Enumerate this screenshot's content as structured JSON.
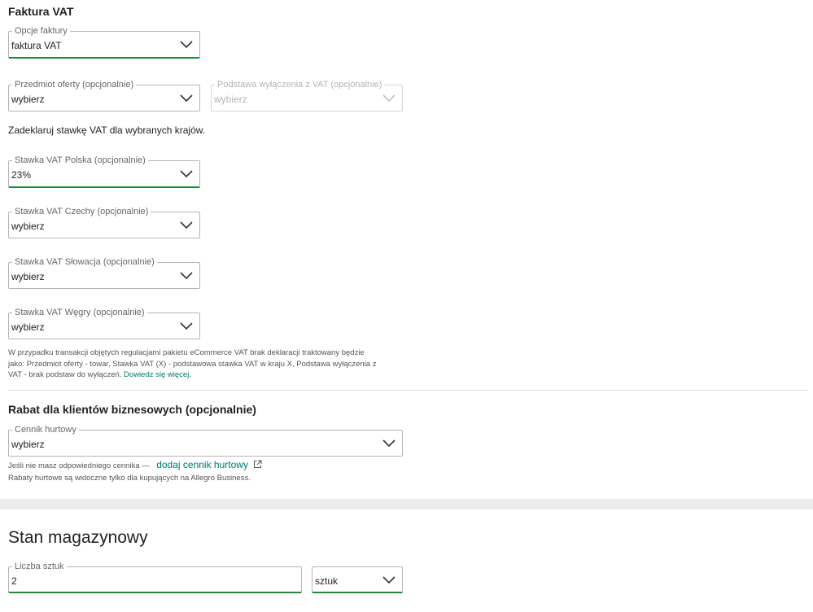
{
  "vat": {
    "title": "Faktura VAT",
    "invoice_options": {
      "label": "Opcje faktury",
      "value": "faktura VAT"
    },
    "subject": {
      "label": "Przedmiot oferty (opcjonalnie)",
      "value": "wybierz"
    },
    "exemption": {
      "label": "Podstawa wyłączenia z VAT (opcjonalnie)",
      "value": "wybierz"
    },
    "declare_text": "Zadeklaruj stawkę VAT dla wybranych krajów.",
    "rates": [
      {
        "label": "Stawka VAT Polska (opcjonalnie)",
        "value": "23%"
      },
      {
        "label": "Stawka VAT Czechy (opcjonalnie)",
        "value": "wybierz"
      },
      {
        "label": "Stawka VAT Słowacja (opcjonalnie)",
        "value": "wybierz"
      },
      {
        "label": "Stawka VAT Węgry (opcjonalnie)",
        "value": "wybierz"
      }
    ],
    "note": {
      "line1": "W przypadku transakcji objętych regulacjami pakietu eCommerce VAT brak deklaracji traktowany będzie",
      "line2": "jako: Przedmiot oferty - towar, Stawka VAT (X) - podstawowa stawka VAT w kraju X, Podstawa wyłączenia z",
      "line3": "VAT - brak podstaw do wyłączeń.",
      "link": "Dowiedz się więcej."
    }
  },
  "discount": {
    "title": "Rabat dla klientów biznesowych (opcjonalnie)",
    "pricelist": {
      "label": "Cennik hurtowy",
      "value": "wybierz"
    },
    "hint_prefix": "Jeśli nie masz odpowiedniego cennika —",
    "hint_link": "dodaj cennik hurtowy",
    "hint2": "Rabaty hurtowe są widoczne tylko dla kupujących na Allegro Business."
  },
  "stock": {
    "title": "Stan magazynowy",
    "quantity": {
      "label": "Liczba sztuk",
      "value": "2"
    },
    "unit": {
      "value": "sztuk"
    }
  },
  "colors": {
    "accent_green": "#1f8a3b",
    "link_teal": "#00796b"
  }
}
